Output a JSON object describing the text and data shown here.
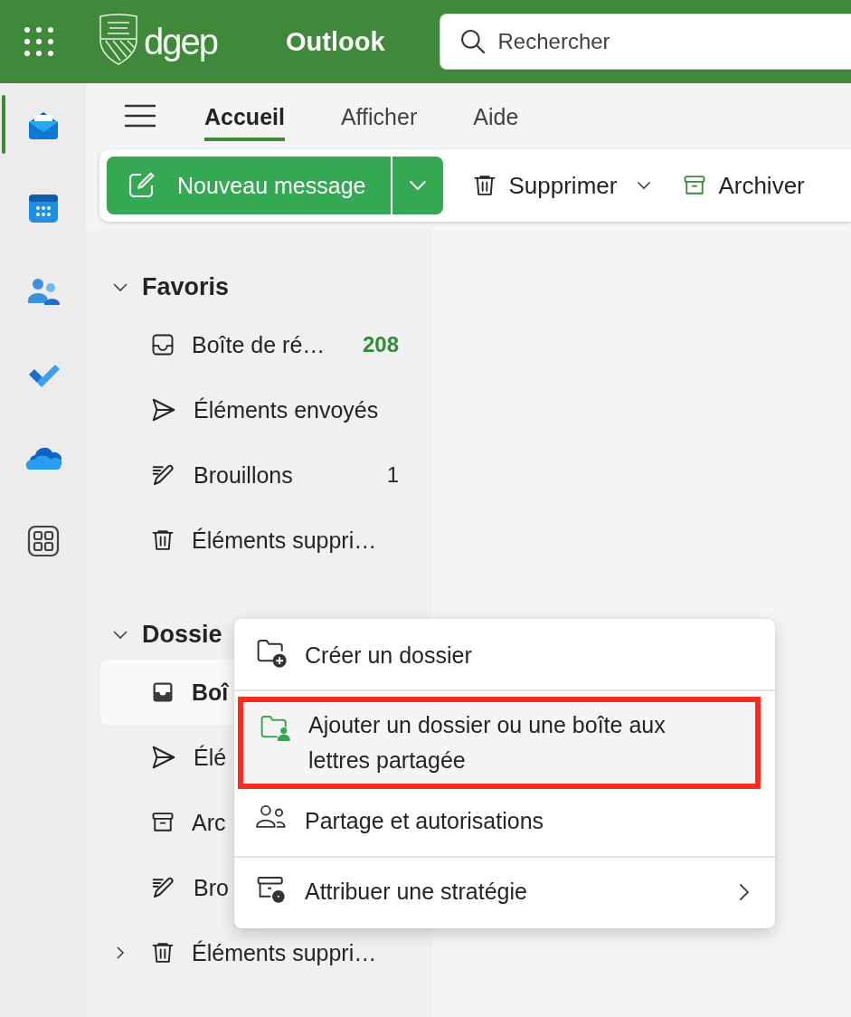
{
  "header": {
    "brand": "dgep",
    "app_name": "Outlook",
    "search": {
      "placeholder": "Rechercher"
    }
  },
  "rail": [
    {
      "kind": "mail",
      "selected": true
    },
    {
      "kind": "calendar",
      "selected": false
    },
    {
      "kind": "people",
      "selected": false
    },
    {
      "kind": "todo",
      "selected": false
    },
    {
      "kind": "cloud",
      "selected": false
    },
    {
      "kind": "apps",
      "selected": false
    }
  ],
  "tabs": [
    {
      "label": "Accueil",
      "selected": true
    },
    {
      "label": "Afficher",
      "selected": false
    },
    {
      "label": "Aide",
      "selected": false
    }
  ],
  "toolbar": {
    "new_message": "Nouveau message",
    "actions": [
      {
        "kind": "delete",
        "label": "Supprimer",
        "dropdown": true
      },
      {
        "kind": "archive",
        "label": "Archiver",
        "dropdown": false
      }
    ]
  },
  "favorites": {
    "title": "Favoris",
    "expanded": true,
    "items": [
      {
        "kind": "inbox",
        "label": "Boîte de ré…",
        "count": "208",
        "unread": true
      },
      {
        "kind": "sent",
        "label": "Éléments envoyés"
      },
      {
        "kind": "drafts",
        "label": "Brouillons",
        "count": "1",
        "unread": false
      },
      {
        "kind": "deleted",
        "label": "Éléments suppri…"
      }
    ]
  },
  "folders": {
    "title": "Dossie",
    "expanded": true,
    "items": [
      {
        "kind": "inbox",
        "label": "Boî",
        "selected": true
      },
      {
        "kind": "sent",
        "label": "Élé",
        "selected": false
      },
      {
        "kind": "archive",
        "label": "Arc",
        "selected": false
      },
      {
        "kind": "drafts",
        "label": "Bro",
        "selected": false
      },
      {
        "kind": "deleted",
        "label": "Éléments suppri…",
        "selected": false,
        "expanded": false
      }
    ]
  },
  "context_menu": {
    "items": [
      {
        "kind": "new-folder",
        "label": "Créer un dossier",
        "highlighted": false
      },
      {
        "kind": "separator"
      },
      {
        "kind": "shared",
        "label": "Ajouter un dossier ou une boîte aux lettres partagée",
        "highlighted": true
      },
      {
        "kind": "permissions",
        "label": "Partage et autorisations",
        "highlighted": false
      },
      {
        "kind": "separator"
      },
      {
        "kind": "policy",
        "label": "Attribuer une stratégie",
        "highlighted": false,
        "submenu": true
      }
    ]
  }
}
